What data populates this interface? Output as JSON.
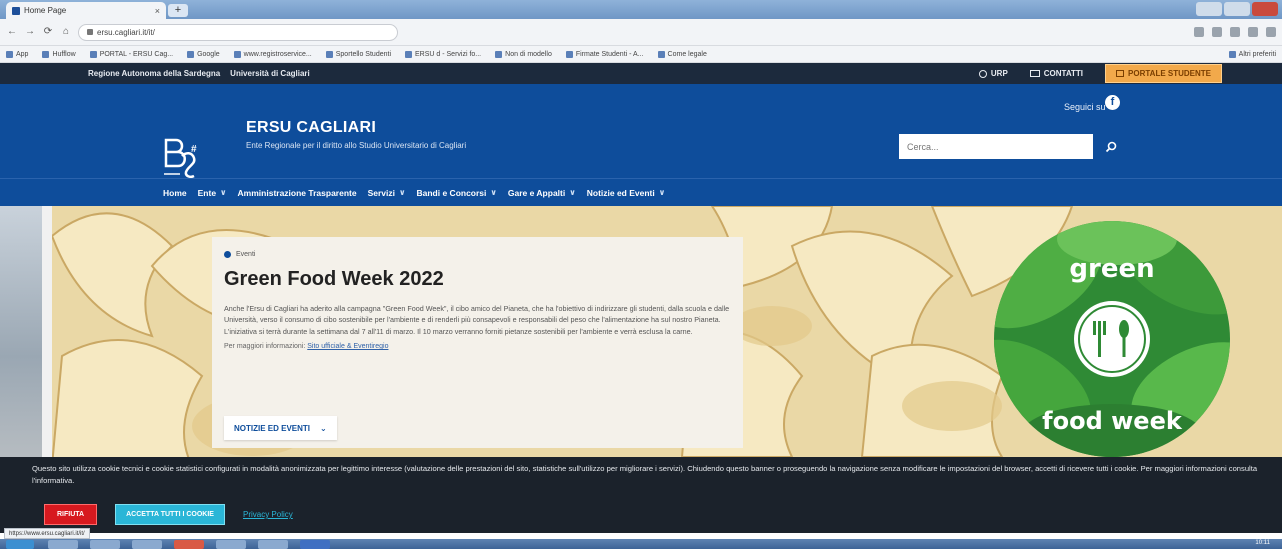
{
  "browser": {
    "tab_title": "Home Page",
    "tab_close": "×",
    "new_tab": "+",
    "address": "ersu.cagliari.it/it/",
    "nav": {
      "back": "←",
      "forward": "→",
      "reload": "⟳",
      "home": "⌂"
    },
    "bookmarks": [
      "App",
      "Hufflow",
      "PORTAL - ERSU Cag...",
      "Google",
      "www.registroservice...",
      "Sportello Studenti",
      "ERSU d - Servizi fo...",
      "Non di modello",
      "Firmate Studenti - A...",
      "Come legale"
    ],
    "bookmarks_other": "Altri preferiti"
  },
  "sitebar": {
    "left": [
      "Regione Autonoma della Sardegna",
      "Università di Cagliari"
    ],
    "urp": "URP",
    "contatti": "CONTATTI",
    "portale": "PORTALE STUDENTE"
  },
  "header": {
    "title": "ERSU CAGLIARI",
    "subtitle": "Ente Regionale per il diritto allo Studio Universitario di Cagliari",
    "seguici": "Seguici su",
    "search_placeholder": "Cerca..."
  },
  "nav": {
    "items": [
      {
        "label": "Home",
        "dropdown": false
      },
      {
        "label": "Ente",
        "dropdown": true
      },
      {
        "label": "Amministrazione Trasparente",
        "dropdown": false
      },
      {
        "label": "Servizi",
        "dropdown": true
      },
      {
        "label": "Bandi e Concorsi",
        "dropdown": true
      },
      {
        "label": "Gare e Appalti",
        "dropdown": true
      },
      {
        "label": "Notizie ed Eventi",
        "dropdown": true
      }
    ]
  },
  "hero": {
    "category": "Eventi",
    "title": "Green Food Week 2022",
    "body": "Anche l'Ersu di Cagliari ha aderito alla campagna \"Green Food Week\", il cibo amico del Pianeta, che ha l'obiettivo di indirizzare gli studenti, dalla scuola e dalle Università, verso il consumo di cibo sostenibile per l'ambiente e di renderli più consapevoli e responsabili del peso che l'alimentazione ha sul nostro Pianeta. L'iniziativa si terrà durante la settimana dal 7 all'11 di marzo. Il 10 marzo verranno forniti pietanze sostenibili per l'ambiente e verrà esclusa la carne.",
    "more_label": "Per maggiori informazioni:",
    "more_link": "Sito ufficiale & Eventiregio",
    "button": "NOTIZIE ED EVENTI",
    "gfw_top": "green",
    "gfw_bottom": "food week"
  },
  "cookie": {
    "text": "Questo sito utilizza cookie tecnici e cookie statistici configurati in modalità anonimizzata per legittimo interesse (valutazione delle prestazioni del sito, statistiche sull'utilizzo per migliorare i servizi). Chiudendo questo banner o proseguendo la navigazione senza modificare le impostazioni del browser, accetti di ricevere tutti i cookie. Per maggiori informazioni consulta l'informativa.",
    "reject": "RIFIUTA",
    "accept": "ACCETTA TUTTI I COOKIE",
    "privacy": "Privacy Policy"
  },
  "status_url": "https://www.ersu.cagliari.it/it/",
  "taskbar": {
    "clock": "10:11"
  },
  "colors": {
    "brand_blue": "#0e4d9b",
    "dark_bar": "#1c2a3d",
    "portale": "#f2a94b",
    "reject": "#d7191f",
    "accept": "#2ab6d7"
  }
}
